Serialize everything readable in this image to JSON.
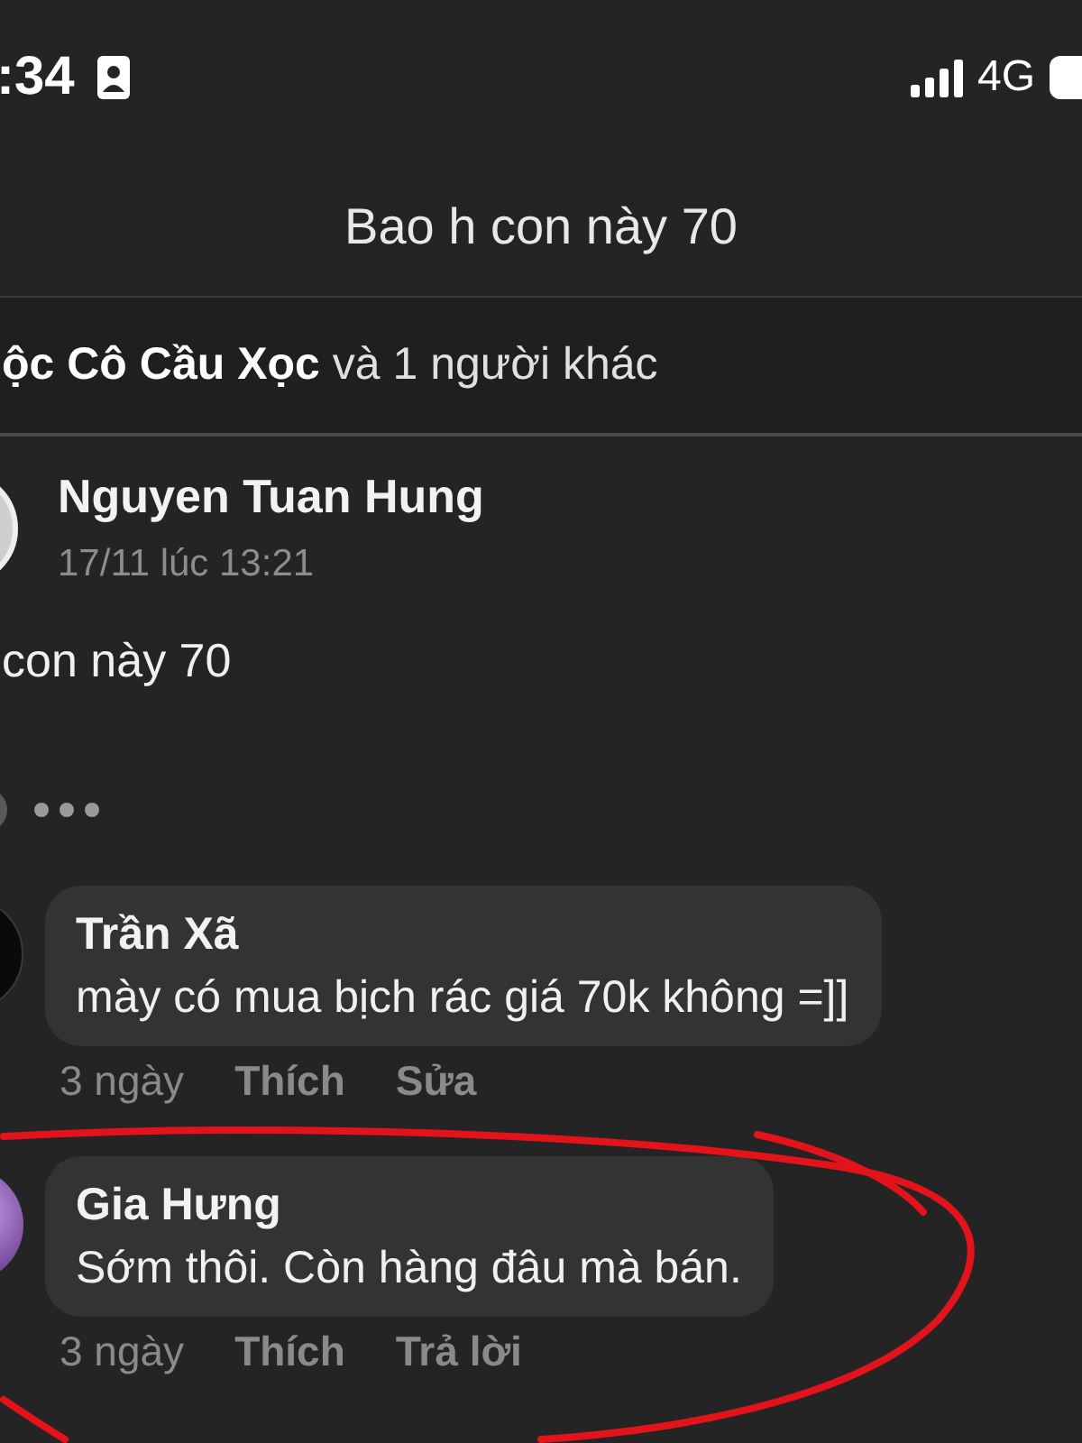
{
  "status_bar": {
    "time": ":34",
    "network": "4G"
  },
  "header": {
    "title": "Bao h con này 70"
  },
  "reactions": {
    "text": "**ộc Cô Cầu Xọc** và 1 người khác"
  },
  "post": {
    "author": "Nguyen Tuan Hung",
    "timestamp": "17/11 lúc 13:21",
    "text": "con này 70"
  },
  "comments": [
    {
      "author": "Trần Xã",
      "text": "mày có mua bịch rác giá 70k không =]]",
      "time": "3 ngày",
      "actions": [
        "Thích",
        "Sửa"
      ]
    },
    {
      "author": "Gia Hưng",
      "text": "Sớm thôi. Còn hàng đâu mà bán.",
      "time": "3 ngày",
      "actions": [
        "Thích",
        "Trả lời"
      ]
    }
  ]
}
